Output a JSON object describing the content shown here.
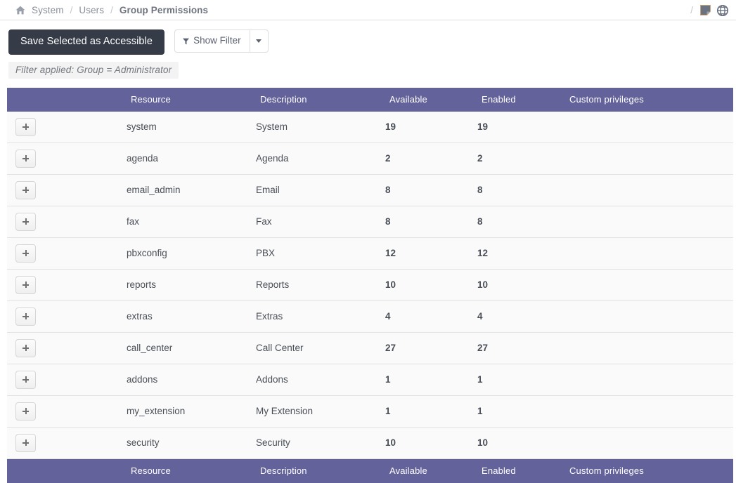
{
  "breadcrumb": {
    "home_icon": "home-icon",
    "items": [
      {
        "label": "System",
        "current": false
      },
      {
        "label": "Users",
        "current": false
      },
      {
        "label": "Group Permissions",
        "current": true
      }
    ],
    "separator": "/",
    "trailing_separator": "/",
    "right_icons": [
      {
        "name": "note-icon",
        "glyph": "note"
      },
      {
        "name": "globe-icon",
        "glyph": "globe"
      }
    ]
  },
  "toolbar": {
    "save_label": "Save Selected as Accessible",
    "show_filter_label": "Show Filter",
    "filter_icon": "funnel-icon",
    "dropdown_icon": "chevron-down-icon"
  },
  "filter_notice": {
    "text": "Filter applied: Group = Administrator"
  },
  "table": {
    "columns": [
      {
        "key": "expand",
        "label": ""
      },
      {
        "key": "spacer",
        "label": ""
      },
      {
        "key": "resource",
        "label": "Resource"
      },
      {
        "key": "description",
        "label": "Description"
      },
      {
        "key": "available",
        "label": "Available"
      },
      {
        "key": "enabled",
        "label": "Enabled"
      },
      {
        "key": "custom_privileges",
        "label": "Custom privileges"
      }
    ],
    "expand_icon": "plus-icon",
    "rows": [
      {
        "resource": "system",
        "description": "System",
        "available": "19",
        "enabled": "19",
        "custom_privileges": ""
      },
      {
        "resource": "agenda",
        "description": "Agenda",
        "available": "2",
        "enabled": "2",
        "custom_privileges": ""
      },
      {
        "resource": "email_admin",
        "description": "Email",
        "available": "8",
        "enabled": "8",
        "custom_privileges": ""
      },
      {
        "resource": "fax",
        "description": "Fax",
        "available": "8",
        "enabled": "8",
        "custom_privileges": ""
      },
      {
        "resource": "pbxconfig",
        "description": "PBX",
        "available": "12",
        "enabled": "12",
        "custom_privileges": ""
      },
      {
        "resource": "reports",
        "description": "Reports",
        "available": "10",
        "enabled": "10",
        "custom_privileges": ""
      },
      {
        "resource": "extras",
        "description": "Extras",
        "available": "4",
        "enabled": "4",
        "custom_privileges": ""
      },
      {
        "resource": "call_center",
        "description": "Call Center",
        "available": "27",
        "enabled": "27",
        "custom_privileges": ""
      },
      {
        "resource": "addons",
        "description": "Addons",
        "available": "1",
        "enabled": "1",
        "custom_privileges": ""
      },
      {
        "resource": "my_extension",
        "description": "My Extension",
        "available": "1",
        "enabled": "1",
        "custom_privileges": ""
      },
      {
        "resource": "security",
        "description": "Security",
        "available": "10",
        "enabled": "10",
        "custom_privileges": ""
      }
    ]
  },
  "colors": {
    "table_header": "#63629b",
    "primary_button": "#353c48",
    "row_background": "#fafafa",
    "row_border": "#e2e2e2",
    "breadcrumb_text": "#8a8f99"
  }
}
